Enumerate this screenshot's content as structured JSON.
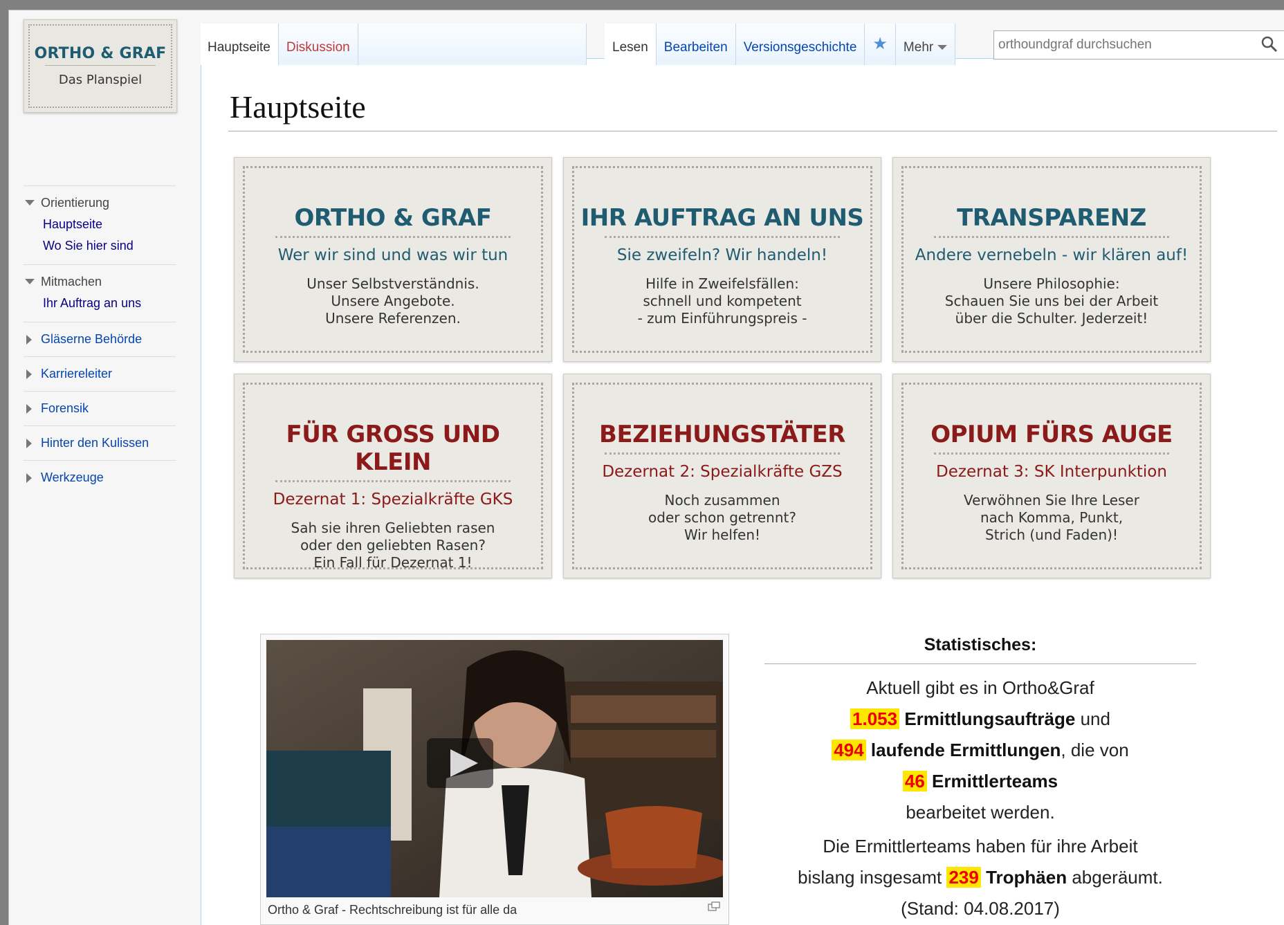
{
  "logo": {
    "line1": "ORTHO & GRAF",
    "line2": "Das Planspiel"
  },
  "sidebar": {
    "sections": [
      {
        "title": "Orientierung",
        "expanded": true,
        "items": [
          "Hauptseite",
          "Wo Sie hier sind"
        ]
      },
      {
        "title": "Mitmachen",
        "expanded": true,
        "items": [
          "Ihr Auftrag an uns"
        ]
      },
      {
        "title": "Gläserne Behörde",
        "expanded": false
      },
      {
        "title": "Karriereleiter",
        "expanded": false
      },
      {
        "title": "Forensik",
        "expanded": false
      },
      {
        "title": "Hinter den Kulissen",
        "expanded": false
      },
      {
        "title": "Werkzeuge",
        "expanded": false
      }
    ]
  },
  "tabs": {
    "left": [
      "Hauptseite",
      "Diskussion"
    ],
    "right": [
      "Lesen",
      "Bearbeiten",
      "Versionsgeschichte"
    ],
    "more": "Mehr"
  },
  "search": {
    "placeholder": "orthoundgraf durchsuchen"
  },
  "page_title": "Hauptseite",
  "cards": [
    {
      "title": "ORTHO & GRAF",
      "subtitle": "Wer wir sind und was wir tun",
      "lines": [
        "Unser Selbstverständnis.",
        "Unsere Angebote.",
        "Unsere Referenzen."
      ],
      "color": "teal"
    },
    {
      "title": "IHR AUFTRAG AN UNS",
      "subtitle": "Sie zweifeln? Wir handeln!",
      "lines": [
        "Hilfe in Zweifelsfällen:",
        "schnell und kompetent",
        "- zum Einführungspreis -"
      ],
      "color": "teal"
    },
    {
      "title": "TRANSPARENZ",
      "subtitle": "Andere vernebeln - wir klären auf!",
      "lines": [
        "Unsere Philosophie:",
        "Schauen Sie uns bei der Arbeit",
        "über die Schulter. Jederzeit!"
      ],
      "color": "teal"
    },
    {
      "title": "FÜR GROSS UND KLEIN",
      "subtitle": "Dezernat 1: Spezialkräfte GKS",
      "lines": [
        "Sah sie ihren Geliebten rasen",
        "oder den geliebten Rasen?",
        "Ein Fall für Dezernat 1!"
      ],
      "color": "red"
    },
    {
      "title": "BEZIEHUNGSTÄTER",
      "subtitle": "Dezernat 2: Spezialkräfte GZS",
      "lines": [
        "Noch zusammen",
        "oder schon getrennt?",
        "Wir helfen!"
      ],
      "color": "red"
    },
    {
      "title": "OPIUM FÜRS AUGE",
      "subtitle": "Dezernat 3: SK Interpunktion",
      "lines": [
        "Verwöhnen Sie Ihre Leser",
        "nach Komma, Punkt,",
        "Strich (und Faden)!"
      ],
      "color": "red"
    }
  ],
  "video": {
    "caption": "Ortho & Graf - Rechtschreibung ist für alle da"
  },
  "stats": {
    "heading": "Statistisches:",
    "intro": "Aktuell gibt es in Ortho&Graf",
    "n1": "1.053",
    "l1": "Ermittlungsaufträge",
    "t1": "und",
    "n2": "494",
    "l2": "laufende Ermittlungen",
    "t2": ", die von",
    "n3": "46",
    "l3": "Ermittlerteams",
    "t3": "bearbeitet werden.",
    "p2a": "Die Ermittlerteams haben für ihre Arbeit",
    "p2b": "bislang insgesamt",
    "n4": "239",
    "l4": "Trophäen",
    "t4": "abgeräumt.",
    "stand": "(Stand: 04.08.2017)"
  },
  "colors": {
    "teal": "#1f5c72",
    "red": "#8b1a1a",
    "link": "#0645ad",
    "highlight": "#ffe600"
  }
}
